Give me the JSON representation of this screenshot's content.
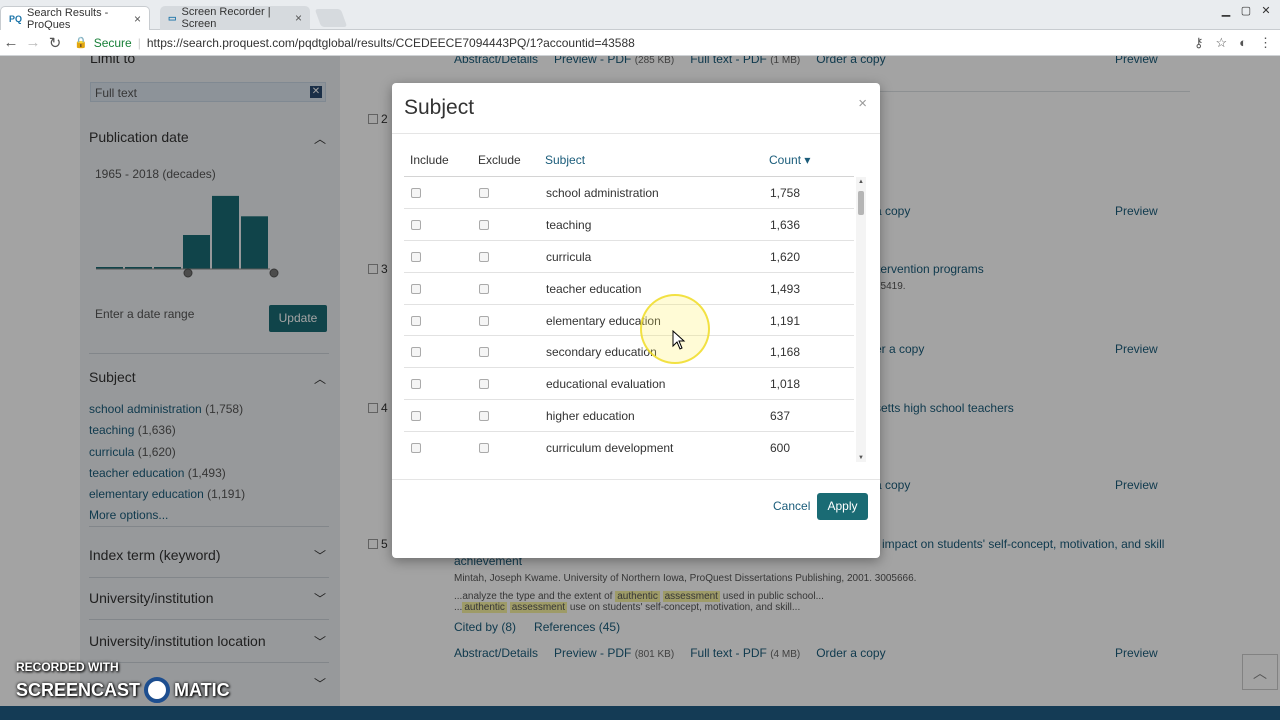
{
  "browser": {
    "tabs": [
      {
        "icon": "PQ",
        "title": "Search Results - ProQues"
      },
      {
        "icon": "",
        "title": "Screen Recorder | Screen"
      }
    ],
    "secure_label": "Secure",
    "url": "https://search.proquest.com/pqdtglobal/results/CCEDEECE7094443PQ/1?accountid=43588"
  },
  "sidebar": {
    "limit_heading": "Limit to",
    "filter_chip": "Full text",
    "publication_date": {
      "title": "Publication date",
      "decades_label": "1965 - 2018 (decades)",
      "histogram": {
        "values": [
          0.02,
          0.02,
          0.02,
          0.4,
          0.86,
          0.62
        ]
      },
      "date_range_label": "Enter a date range",
      "update_label": "Update"
    },
    "subject": {
      "title": "Subject",
      "items": [
        {
          "label": "school administration",
          "count": "(1,758)"
        },
        {
          "label": "teaching",
          "count": "(1,636)"
        },
        {
          "label": "curricula",
          "count": "(1,620)"
        },
        {
          "label": "teacher education",
          "count": "(1,493)"
        },
        {
          "label": "elementary education",
          "count": "(1,191)"
        }
      ],
      "more_label": "More options..."
    },
    "sections": [
      {
        "title": "Index term (keyword)"
      },
      {
        "title": "University/institution"
      },
      {
        "title": "University/institution location"
      }
    ]
  },
  "results": {
    "links": {
      "abstract": "Abstract/Details",
      "preview_pdf": "Preview - PDF",
      "full_text": "Full text - PDF",
      "order": "Order a copy",
      "preview": "Preview"
    },
    "top_row_sizes": {
      "preview": "(285 KB)",
      "full": "(1 MB)"
    },
    "numbers": [
      "2",
      "3",
      "4",
      "5"
    ],
    "partial_texts": [
      "a copy",
      "tervention programs",
      "75419.",
      "er a copy",
      "setts high school teachers",
      "a copy"
    ],
    "item5": {
      "title": "impact on students' self-concept, motivation, and skill",
      "title_line2": "achievement",
      "meta": "Mintah, Joseph Kwame. University of Northern Iowa, ProQuest Dissertations Publishing, 2001. 3005666.",
      "snippet1_pre": "...analyze the type and the extent of",
      "snippet1_h1": "authentic",
      "snippet1_h2": "assessment",
      "snippet1_post": "used in public school...",
      "snippet2_h1": "authentic",
      "snippet2_h2": "assessment",
      "snippet2_post": "use on students' self-concept, motivation, and skill...",
      "cited_by": "Cited by (8)",
      "references": "References (45)",
      "preview_size": "(801 KB)",
      "full_size": "(4 MB)"
    }
  },
  "modal": {
    "title": "Subject",
    "close": "×",
    "headers": {
      "include": "Include",
      "exclude": "Exclude",
      "subject": "Subject",
      "count": "Count ▾"
    },
    "rows": [
      {
        "subject": "school administration",
        "count": "1,758"
      },
      {
        "subject": "teaching",
        "count": "1,636"
      },
      {
        "subject": "curricula",
        "count": "1,620"
      },
      {
        "subject": "teacher education",
        "count": "1,493"
      },
      {
        "subject": "elementary education",
        "count": "1,191"
      },
      {
        "subject": "secondary education",
        "count": "1,168"
      },
      {
        "subject": "educational evaluation",
        "count": "1,018"
      },
      {
        "subject": "higher education",
        "count": "637"
      },
      {
        "subject": "curriculum development",
        "count": "600"
      }
    ],
    "cancel_label": "Cancel",
    "apply_label": "Apply"
  },
  "watermark": {
    "line1": "RECORDED WITH",
    "line2a": "SCREENCAST",
    "line2b": "MATIC"
  },
  "colors": {
    "accent": "#1a6b74",
    "link": "#1a5c7a",
    "highlight": "#f7f2a2"
  }
}
